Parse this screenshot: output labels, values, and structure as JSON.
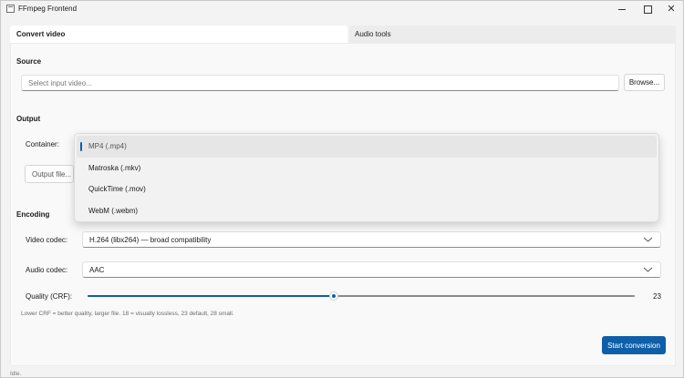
{
  "window": {
    "title": "FFmpeg Frontend",
    "close_glyph": "✕"
  },
  "tabs": [
    {
      "label": "Convert video",
      "active": true
    },
    {
      "label": "Audio tools",
      "active": false
    }
  ],
  "source": {
    "heading": "Source",
    "input_placeholder": "Select input video...",
    "input_value": "",
    "browse_label": "Browse..."
  },
  "output": {
    "heading": "Output",
    "container_label": "Container:",
    "output_file_label": "Output file...",
    "container_options": [
      {
        "label": "MP4 (.mp4)",
        "selected": true
      },
      {
        "label": "Matroska (.mkv)",
        "selected": false
      },
      {
        "label": "QuickTime (.mov)",
        "selected": false
      },
      {
        "label": "WebM (.webm)",
        "selected": false
      }
    ]
  },
  "encoding": {
    "heading": "Encoding",
    "video_codec_label": "Video codec:",
    "video_codec_value": "H.264 (libx264) — broad compatibility",
    "audio_codec_label": "Audio codec:",
    "audio_codec_value": "AAC",
    "quality_label": "Quality (CRF):",
    "quality_value": "23",
    "quality_fraction": 0.45,
    "hint": "Lower CRF = better quality, larger file. 18 = visually lossless, 23 default, 28 small."
  },
  "actions": {
    "start_label": "Start conversion"
  },
  "status": {
    "text": "Idle."
  },
  "colors": {
    "accent": "#0f5ea8",
    "background": "#f3f3f3"
  },
  "icons": [
    "app-icon",
    "minimize-icon",
    "maximize-icon",
    "close-icon",
    "chevron-down-icon"
  ]
}
